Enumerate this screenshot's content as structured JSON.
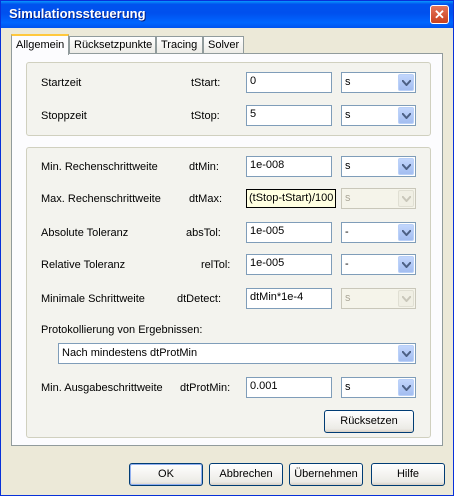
{
  "window": {
    "title": "Simulationssteuerung",
    "close_glyph": "✕"
  },
  "tabs": [
    {
      "label": "Allgemein",
      "active": true
    },
    {
      "label": "Rücksetzpunkte",
      "active": false
    },
    {
      "label": "Tracing",
      "active": false
    },
    {
      "label": "Solver",
      "active": false
    }
  ],
  "time": {
    "start": {
      "label": "Startzeit",
      "param": "tStart:",
      "value": "0",
      "unit": "s"
    },
    "stop": {
      "label": "Stoppzeit",
      "param": "tStop:",
      "value": "5",
      "unit": "s"
    }
  },
  "solver": {
    "dtmin": {
      "label": "Min. Rechenschrittweite",
      "param": "dtMin:",
      "value": "1e-008",
      "unit": "s"
    },
    "dtmax": {
      "label": "Max. Rechenschrittweite",
      "param": "dtMax:",
      "value": "(tStop-tStart)/100",
      "unit": "s",
      "unit_disabled": true
    },
    "abstol": {
      "label": "Absolute Toleranz",
      "param": "absTol:",
      "value": "1e-005",
      "unit": "-"
    },
    "reltol": {
      "label": "Relative Toleranz",
      "param": "relTol:",
      "value": "1e-005",
      "unit": "-"
    },
    "dtdetect": {
      "label": "Minimale Schrittweite",
      "param": "dtDetect:",
      "value": "dtMin*1e-4",
      "unit": "s",
      "unit_disabled": true
    },
    "protocol_label": "Protokollierung von Ergebnissen:",
    "protocol_value": "Nach mindestens dtProtMin",
    "dtprotmin": {
      "label": "Min. Ausgabeschrittweite",
      "param": "dtProtMin:",
      "value": "0.001",
      "unit": "s"
    },
    "reset_label": "Rücksetzen"
  },
  "buttons": {
    "ok": "OK",
    "cancel": "Abbrechen",
    "apply": "Übernehmen",
    "help": "Hilfe"
  },
  "colors": {
    "titlebar": "#0054e3",
    "field_text": "#000080",
    "accent_tab": "#ffc83c"
  }
}
